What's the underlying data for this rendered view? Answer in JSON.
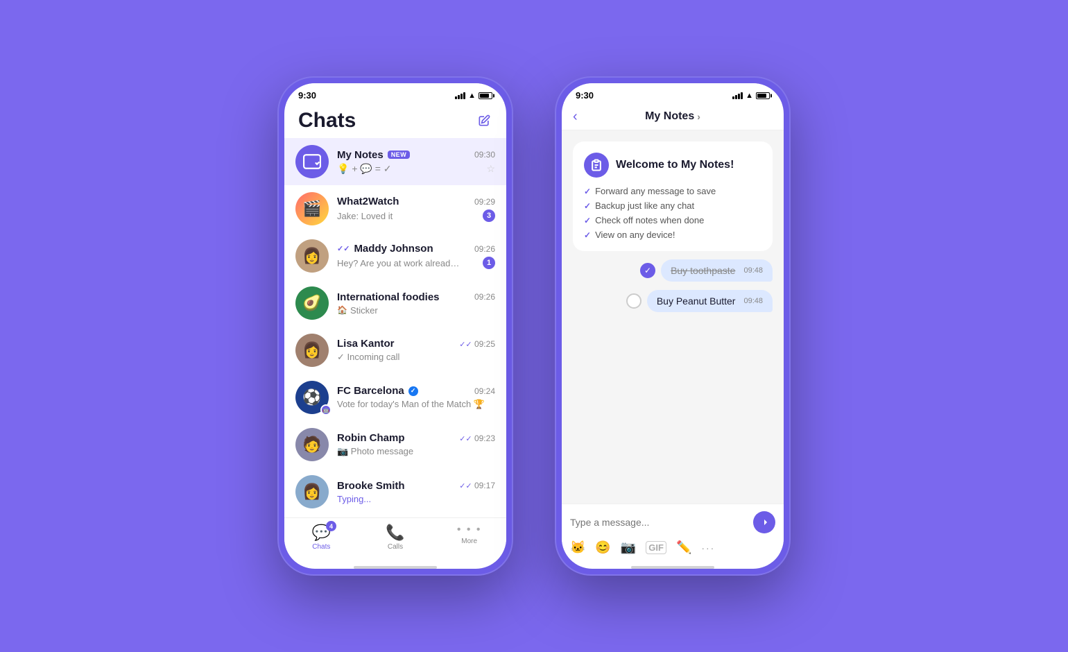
{
  "background_color": "#7B68EE",
  "phone1": {
    "status_time": "9:30",
    "header": {
      "title": "Chats",
      "compose_label": "compose"
    },
    "chats": [
      {
        "id": "my-notes",
        "name": "My Notes",
        "badge": "NEW",
        "time": "09:30",
        "preview_type": "equation",
        "preview": "💡 + 💬 = ✓",
        "highlighted": true,
        "star": true,
        "avatar_type": "notes"
      },
      {
        "id": "what2watch",
        "name": "What2Watch",
        "time": "09:29",
        "preview": "Jake: Loved it",
        "unread": 3,
        "avatar_type": "emoji",
        "avatar_emoji": "🎬"
      },
      {
        "id": "maddy",
        "name": "Maddy Johnson",
        "time": "09:26",
        "preview": "Hey? Are you at work already? I have some questions regarding",
        "unread": 1,
        "read_ticks": true,
        "avatar_type": "color",
        "avatar_class": "av-mj",
        "avatar_emoji": "👩"
      },
      {
        "id": "intl-foodies",
        "name": "International foodies",
        "time": "09:26",
        "preview": "🏠 Sticker",
        "preview_sticker": true,
        "avatar_type": "color",
        "avatar_class": "av-intl",
        "avatar_emoji": "🥑"
      },
      {
        "id": "lisa",
        "name": "Lisa Kantor",
        "time": "09:25",
        "preview": "✓ Incoming call",
        "read_ticks": true,
        "avatar_type": "color",
        "avatar_class": "av-lk",
        "avatar_emoji": "👩"
      },
      {
        "id": "fcb",
        "name": "FC Barcelona",
        "time": "09:24",
        "preview": "Vote for today's Man of the Match 🏆",
        "verified": true,
        "has_bot": true,
        "avatar_type": "color",
        "avatar_class": "av-fcb",
        "avatar_emoji": "⚽"
      },
      {
        "id": "robin",
        "name": "Robin Champ",
        "time": "09:23",
        "preview": "📷 Photo message",
        "read_ticks": true,
        "avatar_type": "color",
        "avatar_class": "av-rc",
        "avatar_emoji": "🧑"
      },
      {
        "id": "brooke",
        "name": "Brooke Smith",
        "time": "09:17",
        "preview": "Typing...",
        "typing": true,
        "read_ticks": true,
        "avatar_type": "color",
        "avatar_class": "av-bs",
        "avatar_emoji": "👩"
      }
    ],
    "tabs": [
      {
        "id": "chats",
        "label": "Chats",
        "active": true,
        "badge": 4,
        "icon": "💬"
      },
      {
        "id": "calls",
        "label": "Calls",
        "icon": "📞"
      },
      {
        "id": "more",
        "label": "More",
        "icon": "···"
      }
    ]
  },
  "phone2": {
    "status_time": "9:30",
    "header": {
      "title": "My Notes",
      "chevron": "›"
    },
    "welcome_card": {
      "title": "Welcome to My Notes!",
      "items": [
        "Forward any message to save",
        "Backup just like any chat",
        "Check off notes when done",
        "View on any device!"
      ]
    },
    "notes": [
      {
        "id": "note1",
        "text": "Buy toothpaste",
        "time": "09:48",
        "done": true
      },
      {
        "id": "note2",
        "text": "Buy Peanut Butter",
        "time": "09:48",
        "done": false
      }
    ],
    "input_placeholder": "Type a message...",
    "toolbar_icons": [
      "sticker",
      "emoji",
      "camera",
      "gif",
      "doodle",
      "more"
    ]
  }
}
